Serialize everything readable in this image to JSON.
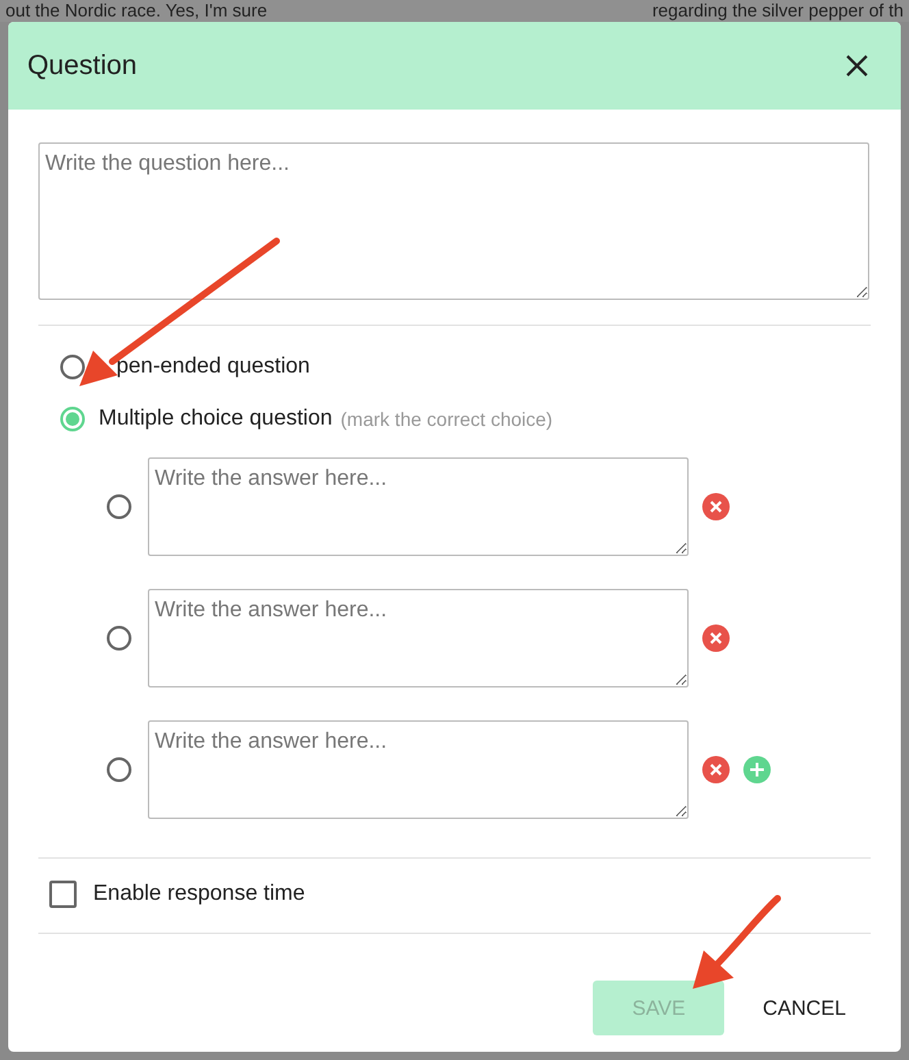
{
  "background_text": [
    "out the Nordic race. Yes, I'm sure",
    "regarding the silver pepper of th"
  ],
  "dialog": {
    "title": "Question"
  },
  "question_field": {
    "placeholder": "Write the question here..."
  },
  "question_types": [
    {
      "label": "pen-ended question",
      "selected": false
    },
    {
      "label": "Multiple choice question",
      "hint": "(mark the correct choice)",
      "selected": true
    }
  ],
  "answers": [
    {
      "placeholder": "Write the answer here...",
      "selected": false,
      "can_add": false
    },
    {
      "placeholder": "Write the answer here...",
      "selected": false,
      "can_add": false
    },
    {
      "placeholder": "Write the answer here...",
      "selected": false,
      "can_add": true
    }
  ],
  "response_time": {
    "label": "Enable response time",
    "checked": false
  },
  "buttons": [
    {
      "label": "SAVE",
      "kind": "primary",
      "disabled": true
    },
    {
      "label": "CANCEL",
      "kind": "text",
      "disabled": false
    }
  ]
}
